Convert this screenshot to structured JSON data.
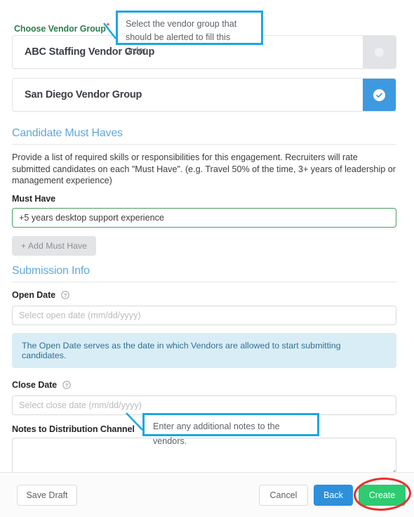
{
  "form": {
    "vendor_group": {
      "label": "Choose Vendor Group",
      "required_marker": "*",
      "options": [
        {
          "name": "ABC Staffing Vendor Group",
          "selected": false
        },
        {
          "name": "San Diego Vendor Group",
          "selected": true
        }
      ]
    },
    "candidate_must_haves": {
      "section_title": "Candidate Must Haves",
      "description": "Provide a list of required skills or responsibilities for this engagement. Recruiters will rate submitted candidates on each \"Must Have\". (e.g. Travel 50% of the time, 3+ years of leadership or management experience)",
      "must_have_label": "Must Have",
      "must_have_value": "+5 years desktop support experience",
      "add_button_label": "+ Add Must Have"
    },
    "submission_info": {
      "section_title": "Submission Info",
      "open_date_label": "Open Date",
      "open_date_value": "",
      "open_date_placeholder": "Select open date (mm/dd/yyyy)",
      "open_date_info": "The Open Date serves as the date in which Vendors are allowed to start submitting candidates.",
      "close_date_label": "Close Date",
      "close_date_value": "",
      "close_date_placeholder": "Select close date (mm/dd/yyyy)",
      "notes_label": "Notes to Distribution Channel",
      "notes_value": "",
      "notes_placeholder": ""
    }
  },
  "footer": {
    "save_draft_label": "Save Draft",
    "cancel_label": "Cancel",
    "back_label": "Back",
    "create_label": "Create"
  },
  "annotations": [
    {
      "id": "vendor",
      "text": "Select the vendor group that should be alerted to fill this order."
    },
    {
      "id": "notes",
      "text": "Enter any additional notes to the vendors."
    }
  ],
  "colors": {
    "accent_blue": "#3d9ae0",
    "section_heading": "#5fa8dd",
    "label_green": "#2e7d4f",
    "required_red": "#e04a4a",
    "info_banner_bg": "#d9edf7",
    "info_banner_text": "#31708f",
    "create_green": "#2ecb71",
    "back_blue": "#2e8fdb",
    "callout_border": "#1ba7e0",
    "highlight_red": "#e8312b",
    "valid_border_green": "#4c9d63"
  }
}
